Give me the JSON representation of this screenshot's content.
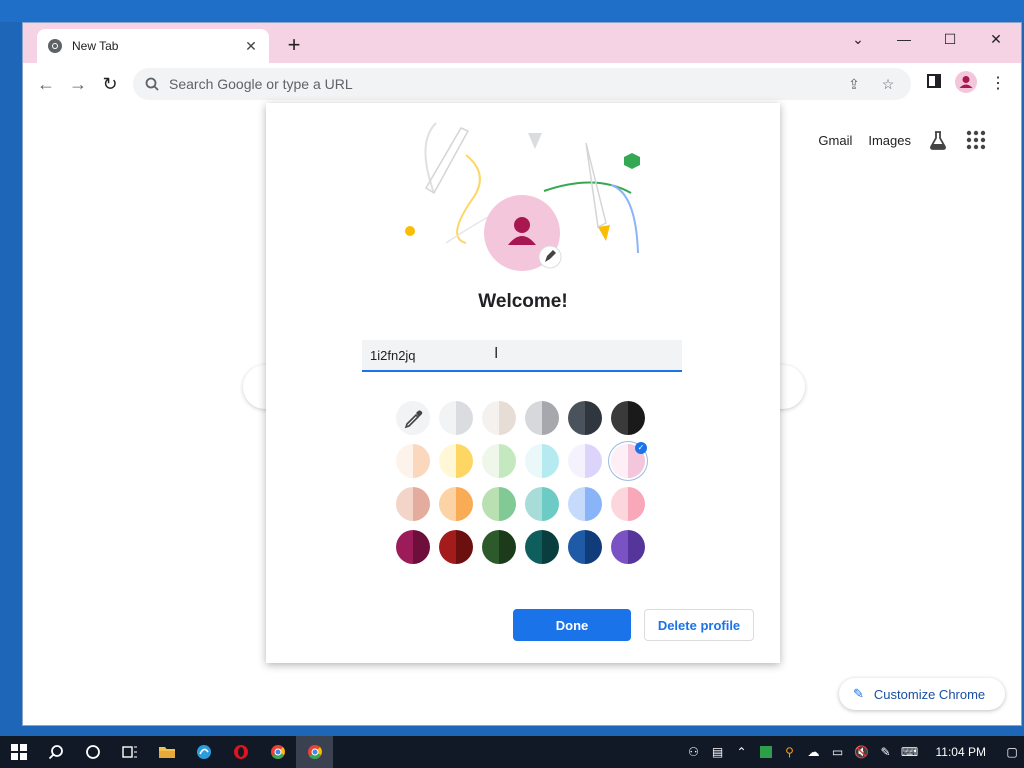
{
  "window": {
    "tab_title": "New Tab",
    "omnibox_placeholder": "Search Google or type a URL"
  },
  "new_tab_page": {
    "links": [
      "Gmail",
      "Images"
    ],
    "customize_label": "Customize Chrome"
  },
  "profile_dialog": {
    "heading": "Welcome!",
    "name_value": "1i2fn2jq",
    "done_label": "Done",
    "delete_label": "Delete profile",
    "avatar_color": "#f4c6db",
    "selected_theme_index": 11,
    "themes": [
      {
        "name": "color-picker",
        "left": "#ffffff",
        "right": "#ffffff"
      },
      {
        "name": "white-grey",
        "left": "#f1f3f4",
        "right": "#dadce0"
      },
      {
        "name": "beige",
        "left": "#f5f1ee",
        "right": "#e6ddd6"
      },
      {
        "name": "grey",
        "left": "#d6d8dc",
        "right": "#a6a8ae"
      },
      {
        "name": "slate",
        "left": "#4a535c",
        "right": "#2f363d"
      },
      {
        "name": "black",
        "left": "#3a3a3a",
        "right": "#1a1a1a"
      },
      {
        "name": "peach-light",
        "left": "#fef3ea",
        "right": "#fbd7bd"
      },
      {
        "name": "yellow",
        "left": "#fff7d6",
        "right": "#fdd663"
      },
      {
        "name": "green-light",
        "left": "#eef7ea",
        "right": "#c4e8bf"
      },
      {
        "name": "cyan-light",
        "left": "#eaf8fa",
        "right": "#b5ebf0"
      },
      {
        "name": "lavender-light",
        "left": "#f5f2fe",
        "right": "#dcd4fb"
      },
      {
        "name": "pink-light",
        "left": "#fdeff5",
        "right": "#f4c6db"
      },
      {
        "name": "salmon",
        "left": "#f3d4c9",
        "right": "#e4ac9c"
      },
      {
        "name": "orange",
        "left": "#fcd3a5",
        "right": "#f9ab55"
      },
      {
        "name": "green",
        "left": "#b8e0b0",
        "right": "#81c995"
      },
      {
        "name": "teal",
        "left": "#a8dcd8",
        "right": "#6ccbc4"
      },
      {
        "name": "blue",
        "left": "#c6dafc",
        "right": "#8ab4f8"
      },
      {
        "name": "pink",
        "left": "#fcd6dd",
        "right": "#f8a8b8"
      },
      {
        "name": "magenta-dark",
        "left": "#9c1c5a",
        "right": "#6e0e3a"
      },
      {
        "name": "red-dark",
        "left": "#a31b1b",
        "right": "#6b0f0f"
      },
      {
        "name": "green-dark",
        "left": "#2d5a2b",
        "right": "#1c3b1b"
      },
      {
        "name": "teal-dark",
        "left": "#0f5e5e",
        "right": "#0a3d3d"
      },
      {
        "name": "blue-dark",
        "left": "#1f5aa6",
        "right": "#103c7a"
      },
      {
        "name": "purple",
        "left": "#7b52c4",
        "right": "#55359a"
      }
    ]
  },
  "taskbar": {
    "time": "11:04 PM"
  }
}
